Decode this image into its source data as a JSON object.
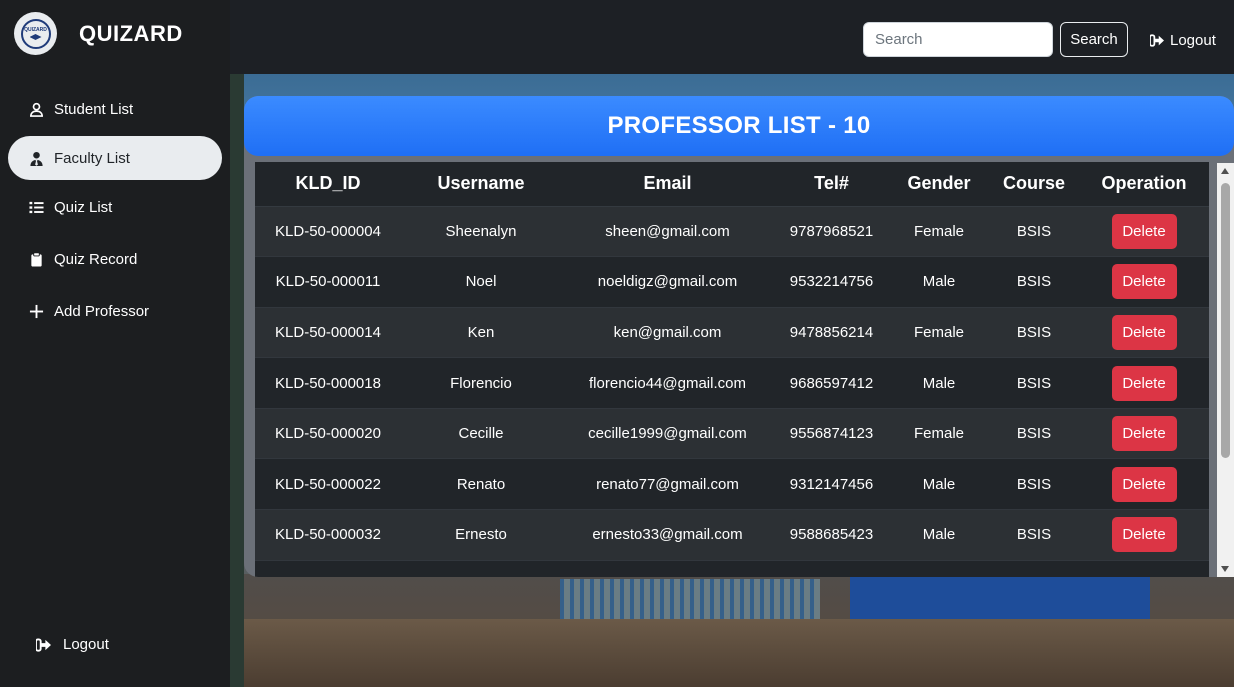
{
  "app": {
    "name": "QUIZARD",
    "logo_text": "QUIZARD"
  },
  "sidebar": {
    "items": [
      {
        "label": "Student List",
        "icon": "user-icon",
        "active": false
      },
      {
        "label": "Faculty List",
        "icon": "user-tie-icon",
        "active": true
      },
      {
        "label": "Quiz List",
        "icon": "list-icon",
        "active": false
      },
      {
        "label": "Quiz Record",
        "icon": "clipboard-icon",
        "active": false
      },
      {
        "label": "Add Professor",
        "icon": "plus-icon",
        "active": false
      }
    ],
    "logout_label": "Logout"
  },
  "topbar": {
    "search_placeholder": "Search",
    "search_button": "Search",
    "logout_label": "Logout"
  },
  "panel": {
    "title": "PROFESSOR LIST - 10"
  },
  "table": {
    "headers": [
      "KLD_ID",
      "Username",
      "Email",
      "Tel#",
      "Gender",
      "Course",
      "Operation"
    ],
    "delete_label": "Delete",
    "rows": [
      {
        "id": "KLD-50-000004",
        "username": "Sheenalyn",
        "email": "sheen@gmail.com",
        "tel": "9787968521",
        "gender": "Female",
        "course": "BSIS"
      },
      {
        "id": "KLD-50-000011",
        "username": "Noel",
        "email": "noeldigz@gmail.com",
        "tel": "9532214756",
        "gender": "Male",
        "course": "BSIS"
      },
      {
        "id": "KLD-50-000014",
        "username": "Ken",
        "email": "ken@gmail.com",
        "tel": "9478856214",
        "gender": "Female",
        "course": "BSIS"
      },
      {
        "id": "KLD-50-000018",
        "username": "Florencio",
        "email": "florencio44@gmail.com",
        "tel": "9686597412",
        "gender": "Male",
        "course": "BSIS"
      },
      {
        "id": "KLD-50-000020",
        "username": "Cecille",
        "email": "cecille1999@gmail.com",
        "tel": "9556874123",
        "gender": "Female",
        "course": "BSIS"
      },
      {
        "id": "KLD-50-000022",
        "username": "Renato",
        "email": "renato77@gmail.com",
        "tel": "9312147456",
        "gender": "Male",
        "course": "BSIS"
      },
      {
        "id": "KLD-50-000032",
        "username": "Ernesto",
        "email": "ernesto33@gmail.com",
        "tel": "9588685423",
        "gender": "Male",
        "course": "BSIS"
      }
    ]
  },
  "colors": {
    "accent": "#1f6ff5",
    "danger": "#dc3545",
    "sidebar": "#1c1e20",
    "table": "#212529"
  }
}
